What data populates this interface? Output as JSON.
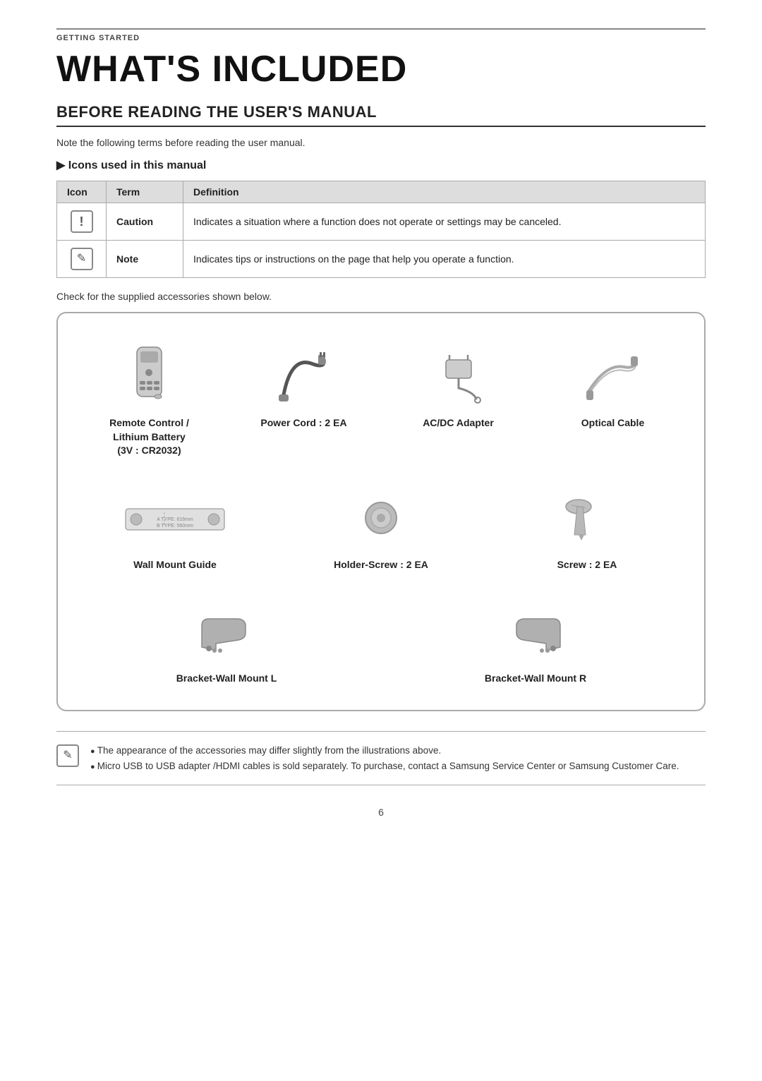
{
  "getting_started": "GETTING STARTED",
  "page_title": "WHAT'S INCLUDED",
  "section_title": "BEFORE READING THE USER'S MANUAL",
  "note_intro": "Note the following terms before reading the user manual.",
  "icons_subtitle": "Icons used in this manual",
  "table": {
    "col1": "Icon",
    "col2": "Term",
    "col3": "Definition",
    "row1_term": "Caution",
    "row1_def": "Indicates a situation where a function does not operate or settings may be canceled.",
    "row2_term": "Note",
    "row2_def": "Indicates tips or instructions on the page that help you operate a function."
  },
  "check_text": "Check for the supplied accessories shown below.",
  "accessories": [
    {
      "label": "Remote Control /\nLithium Battery\n(3V : CR2032)"
    },
    {
      "label": "Power Cord : 2 EA"
    },
    {
      "label": "AC/DC Adapter"
    },
    {
      "label": "Optical Cable"
    },
    {
      "label": "Wall Mount Guide"
    },
    {
      "label": "Holder-Screw : 2 EA"
    },
    {
      "label": "Screw : 2 EA"
    },
    {
      "label": "Bracket-Wall Mount L"
    },
    {
      "label": "Bracket-Wall Mount R"
    }
  ],
  "bottom_notes": [
    "The appearance of the accessories may differ slightly from the illustrations above.",
    "Micro USB to USB adapter /HDMI cables is sold separately. To purchase, contact a Samsung Service Center or Samsung Customer Care."
  ],
  "page_number": "6"
}
